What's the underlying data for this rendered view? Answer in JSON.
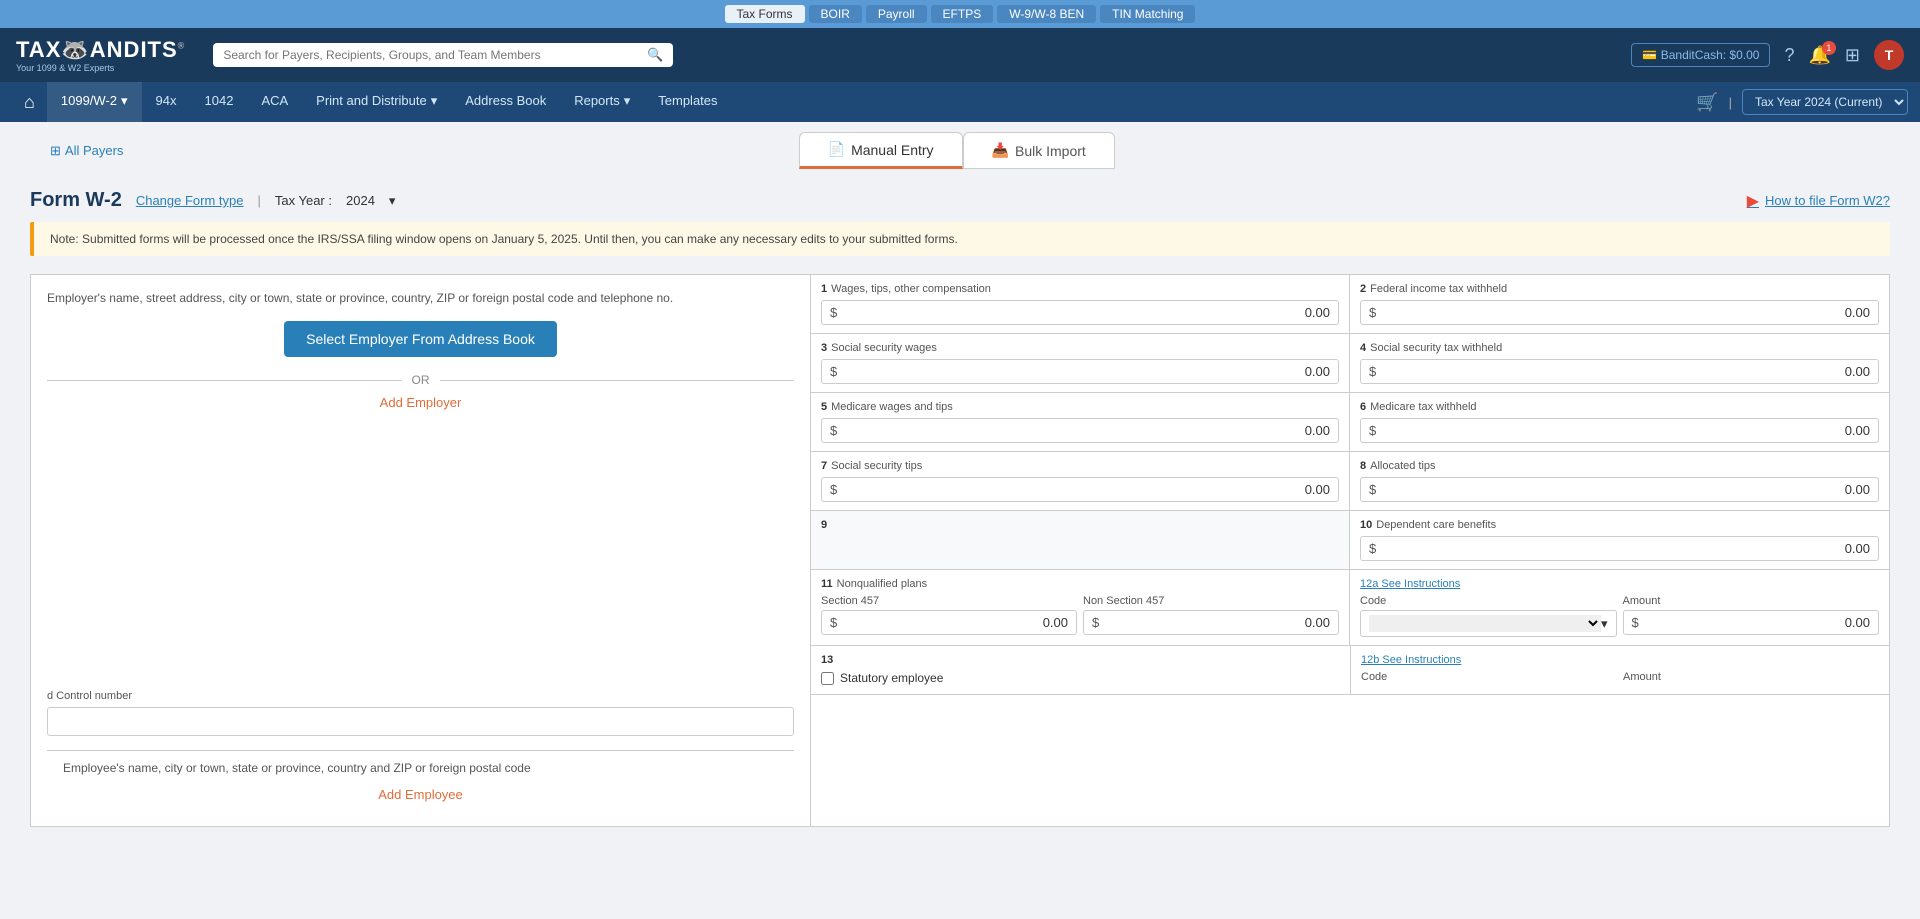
{
  "topbar": {
    "items": [
      {
        "label": "Tax Forms",
        "active": true
      },
      {
        "label": "BOIR",
        "active": false
      },
      {
        "label": "Payroll",
        "active": false
      },
      {
        "label": "EFTPS",
        "active": false
      },
      {
        "label": "W-9/W-8 BEN",
        "active": false
      },
      {
        "label": "TIN Matching",
        "active": false
      }
    ]
  },
  "header": {
    "logo": "TAXBANDITS",
    "logo_sub": "Your 1099 & W2 Experts",
    "search_placeholder": "Search for Payers, Recipients, Groups, and Team Members",
    "bandit_cash": "BanditCash: $0.00"
  },
  "nav": {
    "items": [
      {
        "label": "1099/W-2",
        "has_arrow": true,
        "active": true
      },
      {
        "label": "94x"
      },
      {
        "label": "1042"
      },
      {
        "label": "ACA"
      },
      {
        "label": "Print and Distribute",
        "has_arrow": true
      },
      {
        "label": "Address Book"
      },
      {
        "label": "Reports",
        "has_arrow": true
      },
      {
        "label": "Templates"
      }
    ],
    "year": "Tax Year 2024 (Current)"
  },
  "tabs": {
    "all_payers_label": "All Payers",
    "manual_entry": "Manual Entry",
    "bulk_import": "Bulk Import"
  },
  "form": {
    "title": "Form W-2",
    "change_form_link": "Change Form type",
    "tax_year_label": "Tax Year :",
    "tax_year_value": "2024",
    "how_to_file": "How to file Form W2?",
    "note": "Note: Submitted forms will be processed once the IRS/SSA filing window opens on January 5, 2025. Until then, you can make any necessary edits to your submitted forms.",
    "employer_section_label": "Employer's name, street address, city or town, state or province, country, ZIP or foreign postal code and telephone no.",
    "select_employer_btn": "Select Employer From Address Book",
    "or_text": "OR",
    "add_employer_link": "Add Employer",
    "fields": [
      {
        "num": "1",
        "label": "Wages, tips, other compensation",
        "value": "0.00"
      },
      {
        "num": "2",
        "label": "Federal income tax withheld",
        "value": "0.00"
      },
      {
        "num": "3",
        "label": "Social security wages",
        "value": "0.00"
      },
      {
        "num": "4",
        "label": "Social security tax withheld",
        "value": "0.00"
      },
      {
        "num": "5",
        "label": "Medicare wages and tips",
        "value": "0.00"
      },
      {
        "num": "6",
        "label": "Medicare tax withheld",
        "value": "0.00"
      },
      {
        "num": "7",
        "label": "Social security tips",
        "value": "0.00"
      },
      {
        "num": "8",
        "label": "Allocated tips",
        "value": "0.00"
      },
      {
        "num": "9",
        "label": "",
        "value": ""
      },
      {
        "num": "10",
        "label": "Dependent care benefits",
        "value": "0.00"
      },
      {
        "num": "11",
        "label": "Nonqualified plans",
        "value": ""
      },
      {
        "num": "12a",
        "label": "12a See Instructions",
        "value": ""
      },
      {
        "num": "13",
        "label": "Statutory employee",
        "value": ""
      },
      {
        "num": "12b",
        "label": "12b See Instructions",
        "value": ""
      }
    ],
    "section457_label": "Section 457",
    "section457_value": "0.00",
    "non_section457_label": "Non Section 457",
    "non_section457_value": "0.00",
    "code_label": "Code",
    "amount_label": "Amount",
    "amount_value": "0.00",
    "control_number_label": "d   Control number",
    "statutory_employee": "Statutory employee",
    "employee_section_label": "Employee's name, city or town, state or province, country and ZIP or foreign postal code",
    "add_employee_label": "Add Employee",
    "code_label_12b": "Code",
    "amount_label_12b": "Amount"
  }
}
